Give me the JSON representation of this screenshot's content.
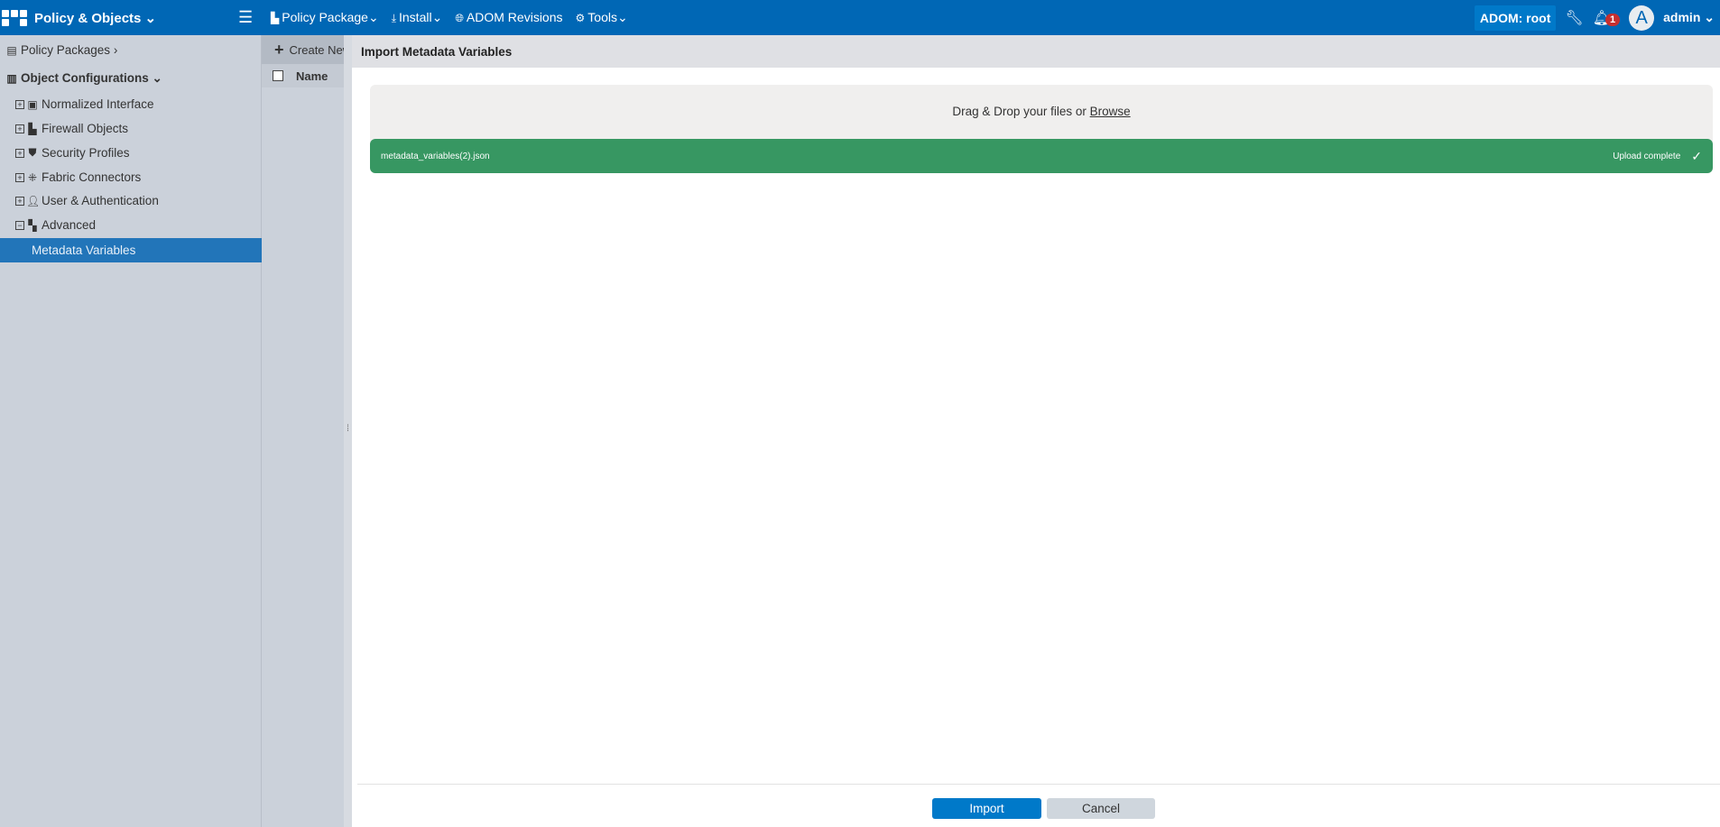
{
  "header": {
    "app_title": "Policy & Objects",
    "nav": [
      {
        "label": "Policy Package",
        "icon": "document-icon"
      },
      {
        "label": "Install",
        "icon": "download-icon"
      },
      {
        "label": "ADOM Revisions",
        "icon": "globe-icon"
      },
      {
        "label": "Tools",
        "icon": "gear-icon"
      }
    ],
    "adom": "ADOM: root",
    "notification_count": "1",
    "avatar_letter": "A",
    "user": "admin"
  },
  "sidebar": {
    "policy_packages": "Policy Packages",
    "object_configurations": "Object Configurations",
    "items": [
      {
        "label": "Normalized Interface",
        "toggle": "+"
      },
      {
        "label": "Firewall Objects",
        "toggle": "+"
      },
      {
        "label": "Security Profiles",
        "toggle": "+"
      },
      {
        "label": "Fabric Connectors",
        "toggle": "+"
      },
      {
        "label": "User & Authentication",
        "toggle": "+"
      },
      {
        "label": "Advanced",
        "toggle": "−"
      }
    ],
    "selected": "Metadata Variables"
  },
  "list": {
    "create_new": "Create New",
    "name_column": "Name"
  },
  "dialog": {
    "title": "Import Metadata Variables",
    "drop_text": "Drag & Drop your files or ",
    "browse": "Browse",
    "file_name": "metadata_variables(2).json",
    "file_status": "Upload complete",
    "import": "Import",
    "cancel": "Cancel"
  },
  "colors": {
    "header": "#0067b5",
    "selected": "#2275b9",
    "upload_success": "#379762",
    "primary_button": "#0079c9"
  }
}
